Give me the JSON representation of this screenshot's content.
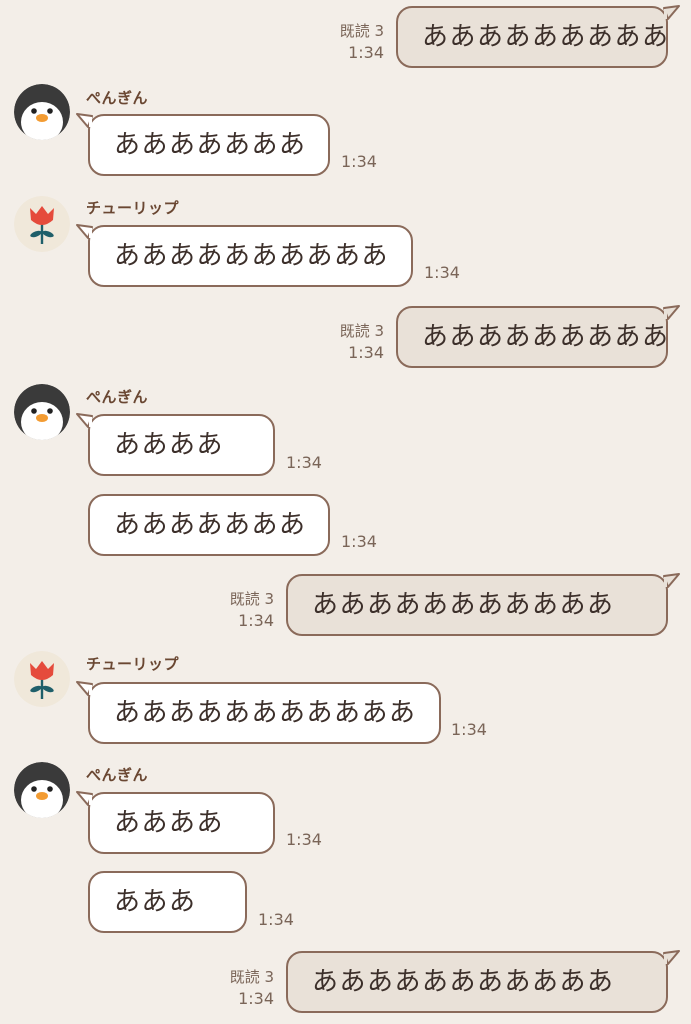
{
  "participants": {
    "penguin": {
      "name": "ぺんぎん",
      "avatar_icon": "penguin-icon"
    },
    "tulip": {
      "name": "チューリップ",
      "avatar_icon": "tulip-icon"
    }
  },
  "read_receipt_label": "既読 3",
  "colors": {
    "background": "#f3eee8",
    "incoming_bubble": "#ffffff",
    "outgoing_bubble": "#e9e1d8",
    "bubble_border": "#8a6a5a",
    "name_text": "#6a4732",
    "meta_text": "#7a6558"
  },
  "messages": [
    {
      "from": "me",
      "text": "あああああああああ",
      "read": "既読 3",
      "time": "1:34"
    },
    {
      "from": "penguin",
      "name": "ぺんぎん",
      "text": "あああああああ",
      "time": "1:34"
    },
    {
      "from": "tulip",
      "name": "チューリップ",
      "text": "ああああああああああ",
      "time": "1:34"
    },
    {
      "from": "me",
      "text": "あああああああああ",
      "read": "既読 3",
      "time": "1:34"
    },
    {
      "from": "penguin",
      "name": "ぺんぎん",
      "text": "ああああ",
      "time": "1:34"
    },
    {
      "from": "penguin",
      "text": "あああああああ",
      "time": "1:34"
    },
    {
      "from": "me",
      "text": "あああああああああああ",
      "read": "既読 3",
      "time": "1:34"
    },
    {
      "from": "tulip",
      "name": "チューリップ",
      "text": "あああああああああああ",
      "time": "1:34"
    },
    {
      "from": "penguin",
      "name": "ぺんぎん",
      "text": "ああああ",
      "time": "1:34"
    },
    {
      "from": "penguin",
      "text": "あああ",
      "time": "1:34"
    },
    {
      "from": "me",
      "text": "あああああああああああ",
      "read": "既読 3",
      "time": "1:34"
    }
  ]
}
